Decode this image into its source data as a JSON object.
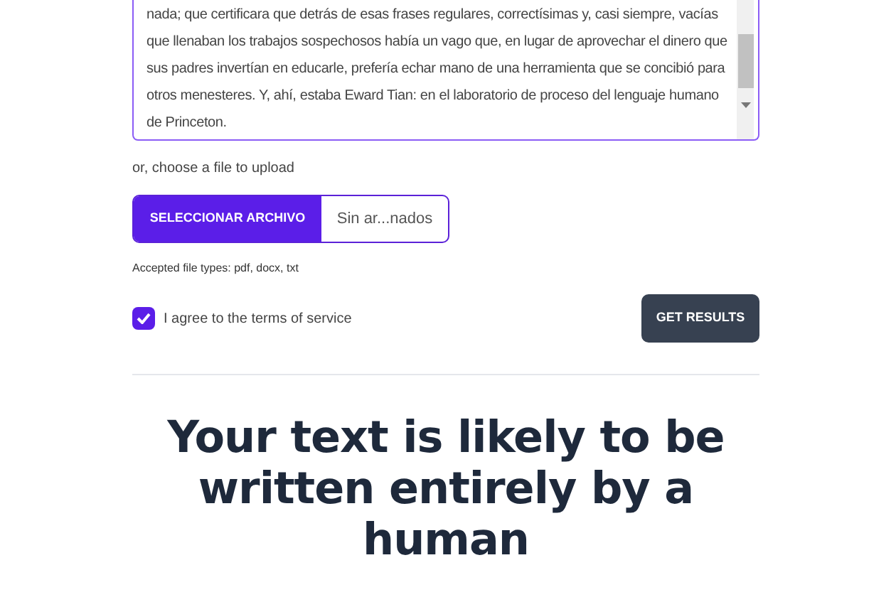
{
  "text_input": {
    "value": "nada; que certificara que detrás de esas frases regulares, correctísimas y, casi siempre, vacías que llenaban los trabajos sospechosos había un vago que, en lugar de aprovechar el dinero que sus padres invertían en educarle, prefería echar mano de una herramienta que se concibió para otros menesteres. Y, ahí, estaba Eward Tian: en el laboratorio de proceso del lenguaje humano de Princeton."
  },
  "upload_label": "or, choose a file to upload",
  "file_picker": {
    "button": "SELECCIONAR ARCHIVO",
    "file_name": "Sin ar...nados"
  },
  "accepted_types": "Accepted file types: pdf, docx, txt",
  "terms": {
    "label": "I agree to the terms of service",
    "checked": true
  },
  "submit_button": "GET RESULTS",
  "result_heading": "Your text is likely to be written entirely by a human"
}
